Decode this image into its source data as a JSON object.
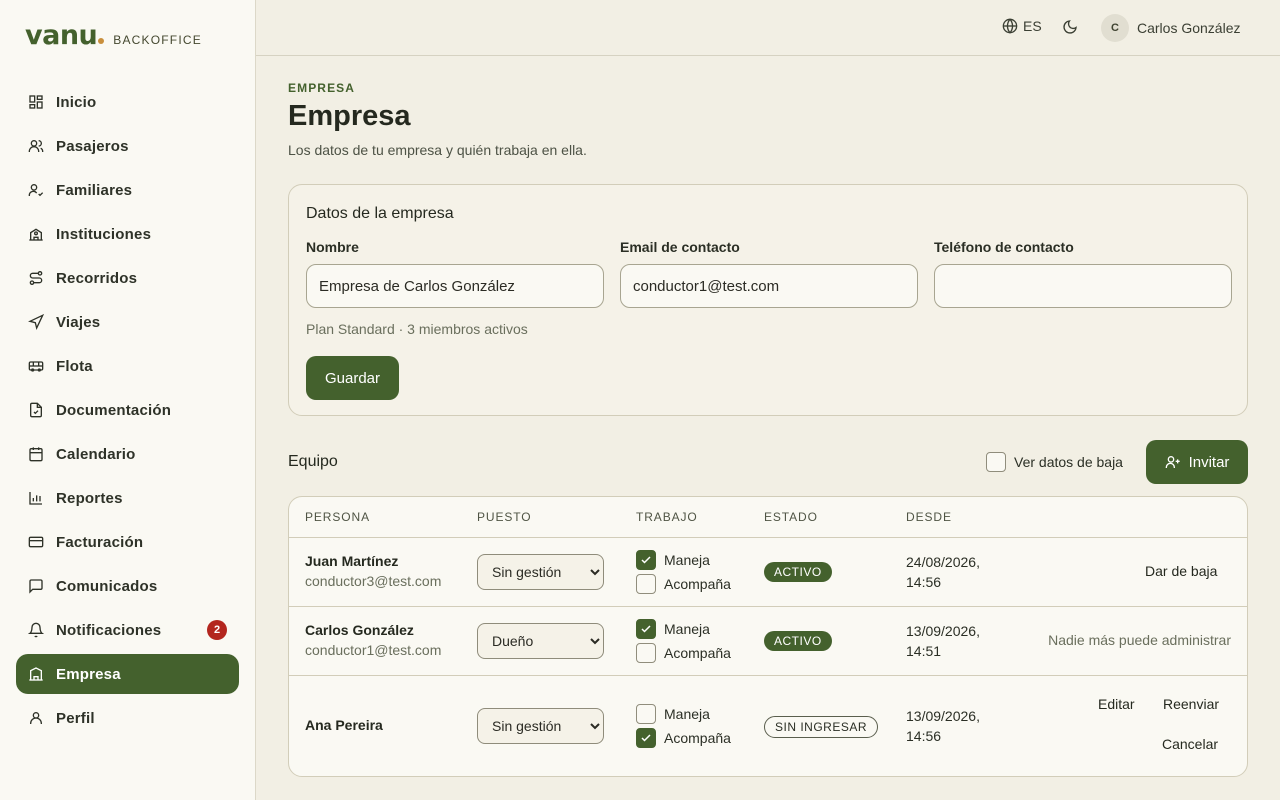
{
  "brand": {
    "logo": "vanu",
    "subtitle": "BACKOFFICE"
  },
  "sidebar": {
    "items": [
      {
        "label": "Inicio",
        "icon": "grid-icon"
      },
      {
        "label": "Pasajeros",
        "icon": "users-icon"
      },
      {
        "label": "Familiares",
        "icon": "user-check-icon"
      },
      {
        "label": "Instituciones",
        "icon": "school-icon"
      },
      {
        "label": "Recorridos",
        "icon": "route-icon"
      },
      {
        "label": "Viajes",
        "icon": "navigation-icon"
      },
      {
        "label": "Flota",
        "icon": "bus-icon"
      },
      {
        "label": "Documentación",
        "icon": "file-check-icon"
      },
      {
        "label": "Calendario",
        "icon": "calendar-icon"
      },
      {
        "label": "Reportes",
        "icon": "bar-chart-icon"
      },
      {
        "label": "Facturación",
        "icon": "credit-card-icon"
      },
      {
        "label": "Comunicados",
        "icon": "message-square-icon"
      },
      {
        "label": "Notificaciones",
        "icon": "bell-icon",
        "badge": "2"
      },
      {
        "label": "Empresa",
        "icon": "building-icon",
        "active": true
      },
      {
        "label": "Perfil",
        "icon": "user-icon"
      }
    ]
  },
  "topbar": {
    "language": "ES",
    "user_initial": "C",
    "user_name": "Carlos González"
  },
  "page": {
    "eyebrow": "EMPRESA",
    "title": "Empresa",
    "subtitle": "Los datos de tu empresa y quién trabaja en ella."
  },
  "company_card": {
    "title": "Datos de la empresa",
    "name_label": "Nombre",
    "name_value": "Empresa de Carlos González",
    "email_label": "Email de contacto",
    "email_value": "conductor1@test.com",
    "phone_label": "Teléfono de contacto",
    "phone_value": "",
    "plan_info": "Plan Standard · 3 miembros activos",
    "save_label": "Guardar"
  },
  "team": {
    "title": "Equipo",
    "show_inactive_label": "Ver datos de baja",
    "show_inactive_checked": false,
    "invite_label": "Invitar",
    "columns": [
      "Persona",
      "Puesto",
      "Trabajo",
      "Estado",
      "Desde"
    ],
    "role_options": [
      "Sin gestión",
      "Dueño"
    ],
    "job_labels": {
      "drives": "Maneja",
      "accompanies": "Acompaña"
    },
    "rows": [
      {
        "name": "Juan Martínez",
        "email": "conductor3@test.com",
        "role": "Sin gestión",
        "drives": true,
        "accompanies": false,
        "status": "ACTIVO",
        "since_date": "24/08/2026,",
        "since_time": "14:56",
        "action": "Dar de baja"
      },
      {
        "name": "Carlos González",
        "email": "conductor1@test.com",
        "role": "Dueño",
        "drives": true,
        "accompanies": false,
        "status": "ACTIVO",
        "since_date": "13/09/2026,",
        "since_time": "14:51",
        "note": "Nadie más puede administrar"
      },
      {
        "name": "Ana Pereira",
        "email": "",
        "role": "Sin gestión",
        "drives": false,
        "accompanies": true,
        "status": "SIN INGRESAR",
        "since_date": "13/09/2026,",
        "since_time": "14:56",
        "edit_label": "Editar",
        "resend_label": "Reenviar",
        "cancel_label": "Cancelar"
      }
    ]
  },
  "colors": {
    "accent": "#44612d",
    "badge_red": "#b3261e",
    "background": "#f2efe4",
    "sidebar_bg": "#faf9f3"
  }
}
